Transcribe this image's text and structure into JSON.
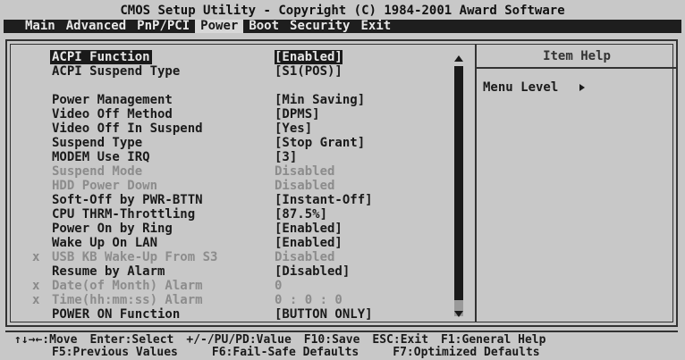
{
  "title": "CMOS Setup Utility - Copyright (C) 1984-2001 Award Software",
  "menu": [
    {
      "label": "Main",
      "active": false
    },
    {
      "label": "Advanced",
      "active": false
    },
    {
      "label": "PnP/PCI",
      "active": false
    },
    {
      "label": "Power",
      "active": true
    },
    {
      "label": "Boot",
      "active": false
    },
    {
      "label": "Security",
      "active": false
    },
    {
      "label": "Exit",
      "active": false
    }
  ],
  "settings": [
    {
      "mark": "",
      "label": "ACPI Function",
      "value": "[Enabled]",
      "state": "selected"
    },
    {
      "mark": "",
      "label": "ACPI Suspend Type",
      "value": "[S1(POS)]",
      "state": "normal"
    },
    {
      "mark": "",
      "label": "Power Management",
      "value": "[Min Saving]",
      "state": "normal"
    },
    {
      "mark": "",
      "label": "Video Off Method",
      "value": "[DPMS]",
      "state": "normal"
    },
    {
      "mark": "",
      "label": "Video Off In Suspend",
      "value": "[Yes]",
      "state": "normal"
    },
    {
      "mark": "",
      "label": "Suspend Type",
      "value": "[Stop Grant]",
      "state": "normal"
    },
    {
      "mark": "",
      "label": "MODEM Use IRQ",
      "value": "[3]",
      "state": "normal"
    },
    {
      "mark": "",
      "label": "Suspend Mode",
      "value": "Disabled",
      "state": "disabled"
    },
    {
      "mark": "",
      "label": "HDD Power Down",
      "value": "Disabled",
      "state": "disabled"
    },
    {
      "mark": "",
      "label": "Soft-Off by PWR-BTTN",
      "value": "[Instant-Off]",
      "state": "normal"
    },
    {
      "mark": "",
      "label": "CPU THRM-Throttling",
      "value": "[87.5%]",
      "state": "normal"
    },
    {
      "mark": "",
      "label": "Power On by Ring",
      "value": "[Enabled]",
      "state": "normal"
    },
    {
      "mark": "",
      "label": "Wake Up On LAN",
      "value": "[Enabled]",
      "state": "normal"
    },
    {
      "mark": "x",
      "label": "USB KB Wake-Up From S3",
      "value": "Disabled",
      "state": "disabled"
    },
    {
      "mark": "",
      "label": "Resume by Alarm",
      "value": "[Disabled]",
      "state": "normal"
    },
    {
      "mark": "x",
      "label": " Date(of Month) Alarm",
      "value": "0",
      "state": "disabled"
    },
    {
      "mark": "x",
      "label": " Time(hh:mm:ss) Alarm",
      "value": "0 :  0 :  0",
      "state": "disabled"
    },
    {
      "mark": "",
      "label": "POWER ON Function",
      "value": "[BUTTON ONLY]",
      "state": "normal"
    }
  ],
  "help": {
    "title": "Item Help",
    "menu_level_label": "Menu Level"
  },
  "footer": {
    "line1": [
      "↑↓→←:Move",
      "Enter:Select",
      "+/-/PU/PD:Value",
      "F10:Save",
      "ESC:Exit",
      "F1:General Help"
    ],
    "line2": [
      "F5:Previous Values",
      "F6:Fail-Safe Defaults",
      "F7:Optimized Defaults"
    ]
  }
}
